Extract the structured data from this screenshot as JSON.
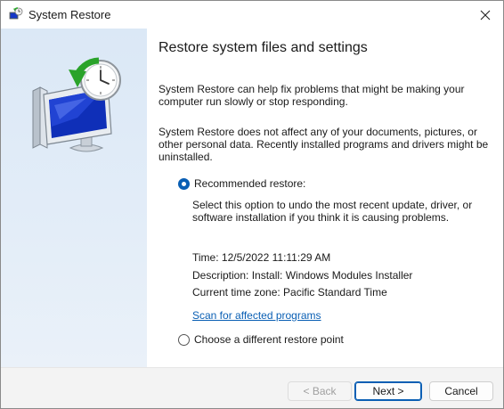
{
  "window": {
    "title": "System Restore",
    "app_icon": "system-restore-icon",
    "close_icon": "close-icon"
  },
  "content": {
    "heading": "Restore system files and settings",
    "para1": "System Restore can help fix problems that might be making your computer run slowly or stop responding.",
    "para2": "System Restore does not affect any of your documents, pictures, or other personal data. Recently installed programs and drivers might be uninstalled.",
    "recommended": {
      "label": "Recommended restore:",
      "selected": true,
      "description": "Select this option to undo the most recent update, driver, or software installation if you think it is causing problems.",
      "time": "Time: 12/5/2022 11:11:29 AM",
      "desc_line": "Description: Install: Windows Modules Installer",
      "timezone": "Current time zone: Pacific Standard Time",
      "scan_link": "Scan for affected programs"
    },
    "different": {
      "label": "Choose a different restore point",
      "selected": false
    }
  },
  "footer": {
    "back_label": "< Back",
    "next_label": "Next >",
    "cancel_label": "Cancel"
  },
  "colors": {
    "accent": "#0a5fb4",
    "sidebar": "#dbe8f6",
    "footer": "#f3f3f3"
  }
}
